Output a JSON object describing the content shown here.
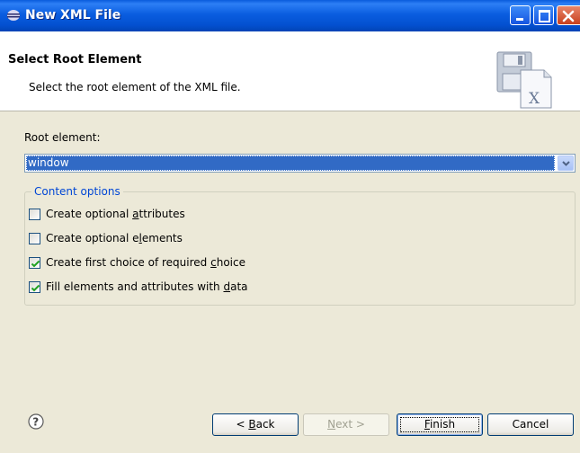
{
  "window": {
    "title": "New XML File"
  },
  "banner": {
    "title": "Select Root Element",
    "description": "Select the root element of the XML file."
  },
  "root_element": {
    "label": "Root element:",
    "selected": "window"
  },
  "content_options": {
    "legend": "Content options",
    "options": [
      {
        "pre": "Create optional ",
        "mnemonic": "a",
        "post": "ttributes",
        "checked": false
      },
      {
        "pre": "Create optional e",
        "mnemonic": "l",
        "post": "ements",
        "checked": false
      },
      {
        "pre": "Create first choice of required ",
        "mnemonic": "c",
        "post": "hoice",
        "checked": true
      },
      {
        "pre": "Fill elements and attributes with ",
        "mnemonic": "d",
        "post": "ata",
        "checked": true
      }
    ]
  },
  "buttons": {
    "back": {
      "pre": "< ",
      "mnemonic": "B",
      "post": "ack"
    },
    "next": {
      "pre": "",
      "mnemonic": "N",
      "post": "ext >"
    },
    "finish": {
      "pre": "",
      "mnemonic": "F",
      "post": "inish"
    },
    "cancel": "Cancel"
  },
  "icons": {
    "title": "eclipse-icon",
    "banner": "xml-file-icon",
    "help": "help-icon"
  }
}
